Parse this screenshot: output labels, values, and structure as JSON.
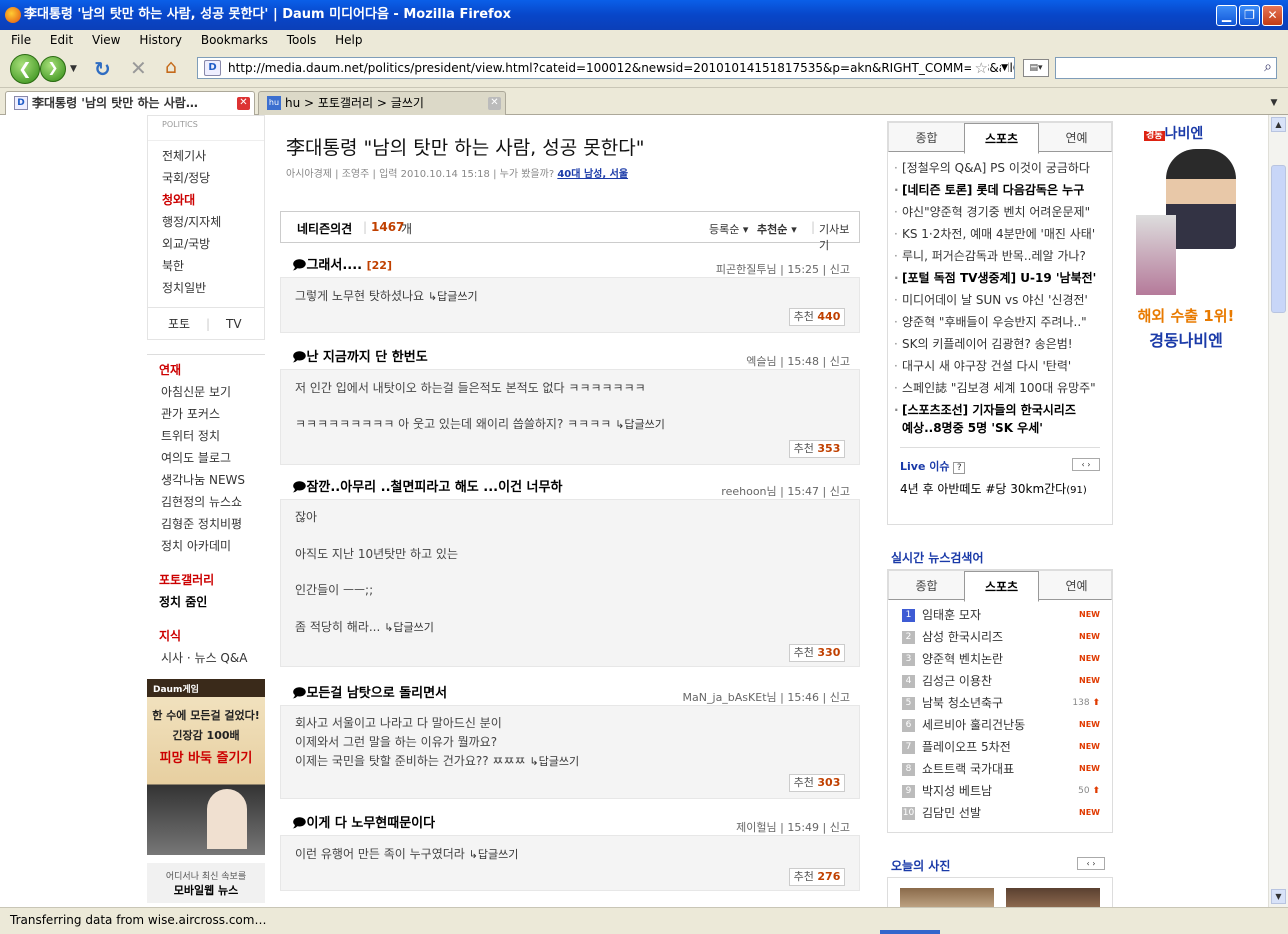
{
  "window": {
    "title": "李대통령 '남의 탓만 하는 사람, 성공 못한다' | Daum 미디어다음 - Mozilla Firefox"
  },
  "menu": [
    "File",
    "Edit",
    "View",
    "History",
    "Bookmarks",
    "Tools",
    "Help"
  ],
  "nav": {
    "url": "http://media.daum.net/politics/president/view.html?cateid=100012&newsid=20101014151817535&p=akn&RIGHT_COMM=R8&allComm"
  },
  "tabs": [
    {
      "label": "李대통령 '남의 탓만 하는 사람…"
    },
    {
      "label": "hu > 포토갤러리 > 글쓰기"
    }
  ],
  "status": "Transferring data from wise.aircross.com…",
  "sidebar": {
    "section_label": "POLITICS",
    "items": [
      "전체기사",
      "국회/정당",
      "청와대",
      "행정/지자체",
      "외교/국방",
      "북한",
      "정치일반"
    ],
    "photo": "포토",
    "tv": "TV",
    "series_head": "연재",
    "series": [
      "아침신문 보기",
      "관가 포커스",
      "트위터 정치",
      "여의도 블로그",
      "생각나눔 NEWS",
      "김현정의 뉴스쇼",
      "김형준 정치비평",
      "정치 아카데미"
    ],
    "gallery_head": "포토갤러리",
    "gallery_item": "정치 줌인",
    "knowledge_head": "지식",
    "knowledge_item": "시사 · 뉴스 Q&A",
    "ad": {
      "logo": "Daum게임",
      "line1": "한 수에 모든걸 걸었다!",
      "line2": "긴장감 100배",
      "line3": "피망 바둑 즐기기"
    },
    "promo": {
      "line1": "어디서나 최신 속보를",
      "line2": "모바일웹 뉴스"
    }
  },
  "article": {
    "title": "李대통령 \"남의 탓만 하는 사람, 성공 못한다\"",
    "source": "아시아경제",
    "reporter": "조영주",
    "date": "입력 2010.10.14 15:18",
    "viewers_label": "누가 봤을까?",
    "viewers": "40대 남성, 서울"
  },
  "comments_header": {
    "label": "네티즌의견",
    "count": "1467",
    "unit": "개",
    "sort1": "등록순",
    "sort2": "추천순",
    "view_article": "기사보기"
  },
  "comments": [
    {
      "title": "그래서.... ",
      "reply_count": "[22]",
      "author": "피곤한질투님",
      "time": "15:25",
      "report": "신고",
      "lines": [
        "그렇게 노무현 탓하셨나요"
      ],
      "reply": "답글쓰기",
      "rec_label": "추천",
      "rec": "440"
    },
    {
      "title": "난 지금까지 단 한번도",
      "author": "엑슬님",
      "time": "15:48",
      "report": "신고",
      "lines": [
        "저 인간 입에서 내탓이오 하는걸 들은적도 본적도 없다 ㅋㅋㅋㅋㅋㅋㅋ",
        "",
        "ㅋㅋㅋㅋㅋㅋㅋㅋㅋ 아 웃고 있는데 왜이리 씁쓸하지? ㅋㅋㅋㅋ"
      ],
      "reply": "답글쓰기",
      "rec_label": "추천",
      "rec": "353"
    },
    {
      "title": "잠깐..아무리 ..철면피라고 해도 ...이건 너무하",
      "author": "reehoon님",
      "time": "15:47",
      "report": "신고",
      "lines": [
        "잖아",
        "",
        "아직도 지난 10년탓만 하고 있는",
        "",
        "인간들이 ㅡㅡ;;",
        "",
        "좀 적당히 해라..."
      ],
      "reply": "답글쓰기",
      "rec_label": "추천",
      "rec": "330"
    },
    {
      "title": "모든걸 남탓으로 돌리면서",
      "author": "MaN_ja_bAsKEt님",
      "time": "15:46",
      "report": "신고",
      "lines": [
        "회사고 서울이고 나라고 다 말아드신 분이",
        "이제와서 그런 말을 하는 이유가 뭘까요?",
        "이제는 국민을 탓할 준비하는 건가요?? ㅉㅉㅉ"
      ],
      "reply": "답글쓰기",
      "rec_label": "추천",
      "rec": "303"
    },
    {
      "title": "이게 다 노무현때문이다",
      "author": "제이헐님",
      "time": "15:49",
      "report": "신고",
      "lines": [
        "이런 유행어 만든 족이 누구였더라"
      ],
      "reply": "답글쓰기",
      "rec_label": "추천",
      "rec": "276"
    }
  ],
  "right": {
    "tabs": [
      "종합",
      "스포츠",
      "연예"
    ],
    "news": [
      {
        "t": "[정철우의 Q&A] PS 이것이 궁금하다",
        "b": false
      },
      {
        "t": "[네티즌 토론] 롯데 다음감독은 누구",
        "b": true
      },
      {
        "t": "야신\"양준혁 경기중 벤치 어려운문제\"",
        "b": false
      },
      {
        "t": "KS 1·2차전, 예매 4분만에 '매진 사태'",
        "b": false
      },
      {
        "t": "루니, 퍼거슨감독과 반목..레알 가나?",
        "b": false
      },
      {
        "t": "[포털 독점 TV생중계] U-19 '남북전'",
        "b": true
      },
      {
        "t": "미디어데이 날 SUN vs 야신 '신경전'",
        "b": false
      },
      {
        "t": "양준혁 \"후배들이 우승반지 주려나..\"",
        "b": false
      },
      {
        "t": "SK의 키플레이어 김광현? 송은범!",
        "b": false
      },
      {
        "t": "대구시 새 야구장 건설 다시 '탄력'",
        "b": false
      },
      {
        "t": "스페인誌 \"김보경 세계 100대 유망주\"",
        "b": false
      },
      {
        "t": "[스포츠조선] 기자들의 한국시리즈",
        "b": true
      }
    ],
    "news_cont": "예상..8명중 5명 'SK 우세'",
    "live_label": "Live 이슈",
    "live_help": "?",
    "live_item": "4년 후 아반떼도 #당 30km간다",
    "live_count": "(91)",
    "realtime_head": "실시간 뉴스검색어",
    "rank_tabs": [
      "종합",
      "스포츠",
      "연예"
    ],
    "ranks": [
      {
        "n": "1",
        "t": "임태훈 모자",
        "s": "NEW"
      },
      {
        "n": "2",
        "t": "삼성 한국시리즈",
        "s": "NEW"
      },
      {
        "n": "3",
        "t": "양준혁 벤치논란",
        "s": "NEW"
      },
      {
        "n": "4",
        "t": "김성근 이용찬",
        "s": "NEW"
      },
      {
        "n": "5",
        "t": "남북 청소년축구",
        "s": "138"
      },
      {
        "n": "6",
        "t": "세르비아 훌리건난동",
        "s": "NEW"
      },
      {
        "n": "7",
        "t": "플레이오프 5차전",
        "s": "NEW"
      },
      {
        "n": "8",
        "t": "쇼트트랙 국가대표",
        "s": "NEW"
      },
      {
        "n": "9",
        "t": "박지성 베트남",
        "s": "50"
      },
      {
        "n": "10",
        "t": "김담민 선발",
        "s": "NEW"
      }
    ],
    "photo_head": "오늘의 사진"
  },
  "ad_right": {
    "brand_small": "경동",
    "brand": "나비엔",
    "line1": "해외 수출 1위!",
    "line2": "경동나비엔"
  }
}
